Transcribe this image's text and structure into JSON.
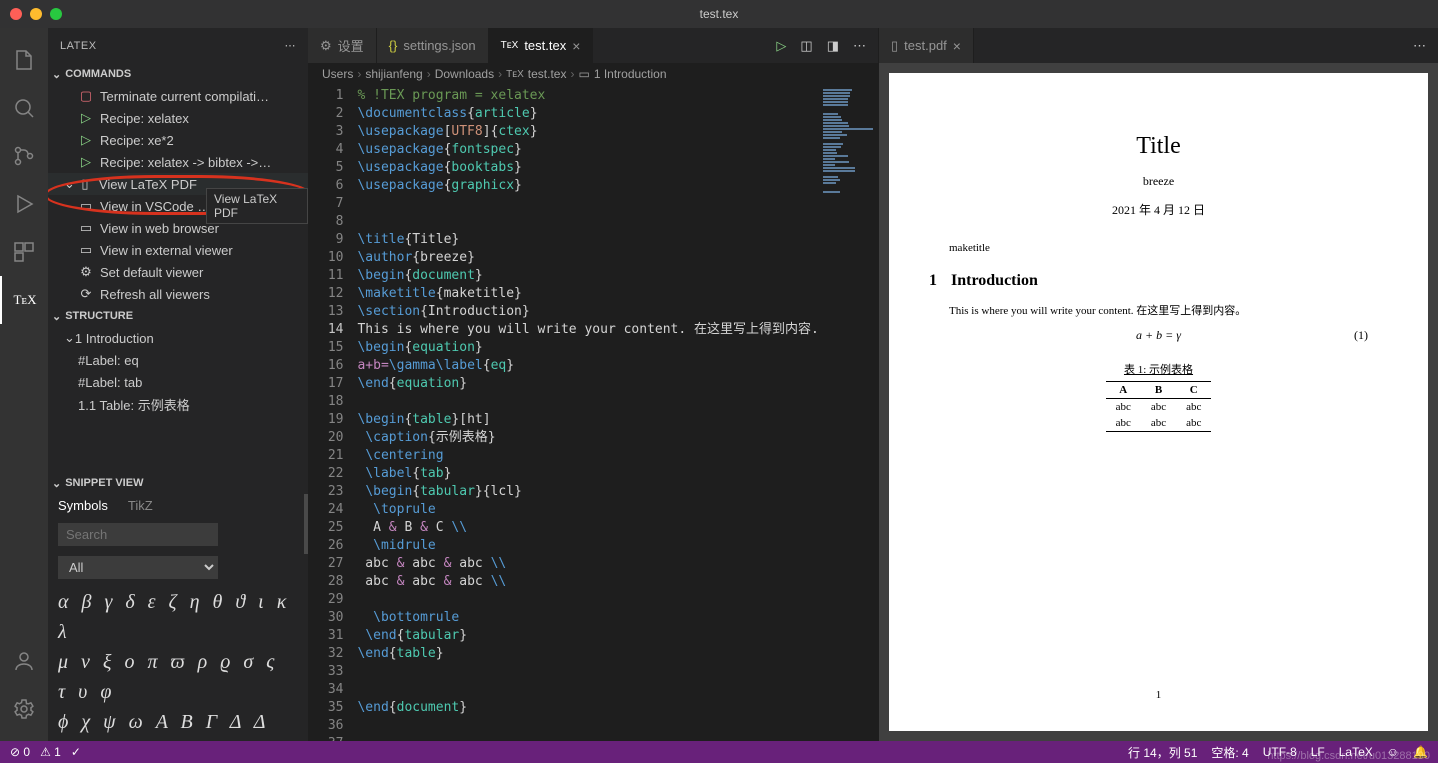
{
  "window": {
    "title": "test.tex"
  },
  "sidebar": {
    "title": "LATEX",
    "sections": {
      "commands": {
        "label": "COMMANDS",
        "items": [
          {
            "label": "Terminate current compilati…"
          },
          {
            "label": "Recipe: xelatex"
          },
          {
            "label": "Recipe: xe*2"
          },
          {
            "label": "Recipe: xelatex -> bibtex ->…"
          }
        ],
        "view_pdf": {
          "label": "View LaTeX PDF",
          "tooltip": "View LaTeX PDF"
        },
        "view_items": [
          {
            "label": "View in VSCode …"
          },
          {
            "label": "View in web browser"
          },
          {
            "label": "View in external viewer"
          },
          {
            "label": "Set default viewer"
          },
          {
            "label": "Refresh all viewers"
          }
        ]
      },
      "structure": {
        "label": "STRUCTURE",
        "items": [
          {
            "label": "1 Introduction"
          },
          {
            "label": "#Label: eq"
          },
          {
            "label": "#Label: tab"
          },
          {
            "label": "1.1 Table:  示例表格"
          }
        ]
      },
      "snippet": {
        "label": "SNIPPET VIEW",
        "tabs": {
          "symbols": "Symbols",
          "tikz": "TikZ"
        },
        "search_placeholder": "Search",
        "select_value": "All",
        "rows": [
          "α β γ δ ε ζ η θ ϑ ι κ λ",
          "μ ν ξ o π ϖ ρ ϱ σ ς τ υ φ",
          "ϕ χ ψ ω A B Γ Δ Δ"
        ]
      }
    }
  },
  "tabs": {
    "left": [
      {
        "icon": "gear",
        "label": "设置"
      },
      {
        "icon": "braces",
        "label": "settings.json"
      },
      {
        "icon": "tex",
        "label": "test.tex",
        "active": true,
        "close": true
      }
    ],
    "right": [
      {
        "icon": "file",
        "label": "test.pdf",
        "close": true
      }
    ]
  },
  "breadcrumb": [
    "Users",
    "shijianfeng",
    "Downloads",
    "test.tex",
    "1 Introduction"
  ],
  "editor": {
    "current_line": 14,
    "lines": [
      {
        "n": 1,
        "html": "<span class='tok-c'>% !TEX program = xelatex</span>"
      },
      {
        "n": 2,
        "html": "<span class='tok-k'>\\documentclass</span>{<span class='tok-f'>article</span>}"
      },
      {
        "n": 3,
        "html": "<span class='tok-k'>\\usepackage</span>[<span class='tok-s'>UTF8</span>]{<span class='tok-f'>ctex</span>}"
      },
      {
        "n": 4,
        "html": "<span class='tok-k'>\\usepackage</span>{<span class='tok-f'>fontspec</span>}"
      },
      {
        "n": 5,
        "html": "<span class='tok-k'>\\usepackage</span>{<span class='tok-f'>booktabs</span>}"
      },
      {
        "n": 6,
        "html": "<span class='tok-k'>\\usepackage</span>{<span class='tok-f'>graphicx</span>}"
      },
      {
        "n": 7,
        "html": ""
      },
      {
        "n": 8,
        "html": ""
      },
      {
        "n": 9,
        "html": "<span class='tok-k'>\\title</span>{Title}"
      },
      {
        "n": 10,
        "html": "<span class='tok-k'>\\author</span>{breeze}"
      },
      {
        "n": 11,
        "html": "<span class='tok-k'>\\begin</span>{<span class='tok-f'>document</span>}"
      },
      {
        "n": 12,
        "html": "<span class='tok-k'>\\maketitle</span>{maketitle}"
      },
      {
        "n": 13,
        "html": "<span class='tok-k'>\\section</span>{Introduction}"
      },
      {
        "n": 14,
        "html": "This is where you will write your content. 在这里写上得到内容."
      },
      {
        "n": 15,
        "html": "<span class='tok-k'>\\begin</span>{<span class='tok-f'>equation</span>}"
      },
      {
        "n": 16,
        "html": "<span class='tok-p'>a+b=</span><span class='tok-k'>\\gamma</span><span class='tok-k'>\\label</span>{<span class='tok-f'>eq</span>}"
      },
      {
        "n": 17,
        "html": "<span class='tok-k'>\\end</span>{<span class='tok-f'>equation</span>}"
      },
      {
        "n": 18,
        "html": ""
      },
      {
        "n": 19,
        "html": "<span class='tok-k'>\\begin</span>{<span class='tok-f'>table</span>}[ht]"
      },
      {
        "n": 20,
        "html": " <span class='tok-k'>\\caption</span>{示例表格}"
      },
      {
        "n": 21,
        "html": " <span class='tok-k'>\\centering</span>"
      },
      {
        "n": 22,
        "html": " <span class='tok-k'>\\label</span>{<span class='tok-f'>tab</span>}"
      },
      {
        "n": 23,
        "html": " <span class='tok-k'>\\begin</span>{<span class='tok-f'>tabular</span>}{lcl}"
      },
      {
        "n": 24,
        "html": "  <span class='tok-k'>\\toprule</span>"
      },
      {
        "n": 25,
        "html": "  A <span class='tok-p'>&amp;</span> B <span class='tok-p'>&amp;</span> C <span class='tok-k'>\\\\</span>"
      },
      {
        "n": 26,
        "html": "  <span class='tok-k'>\\midrule</span>"
      },
      {
        "n": 27,
        "html": " abc <span class='tok-p'>&amp;</span> abc <span class='tok-p'>&amp;</span> abc <span class='tok-k'>\\\\</span>"
      },
      {
        "n": 28,
        "html": " abc <span class='tok-p'>&amp;</span> abc <span class='tok-p'>&amp;</span> abc <span class='tok-k'>\\\\</span>"
      },
      {
        "n": 29,
        "html": ""
      },
      {
        "n": 30,
        "html": "  <span class='tok-k'>\\bottomrule</span>"
      },
      {
        "n": 31,
        "html": " <span class='tok-k'>\\end</span>{<span class='tok-f'>tabular</span>}"
      },
      {
        "n": 32,
        "html": "<span class='tok-k'>\\end</span>{<span class='tok-f'>table</span>}"
      },
      {
        "n": 33,
        "html": ""
      },
      {
        "n": 34,
        "html": ""
      },
      {
        "n": 35,
        "html": "<span class='tok-k'>\\end</span>{<span class='tok-f'>document</span>}"
      },
      {
        "n": 36,
        "html": ""
      },
      {
        "n": 37,
        "html": ""
      }
    ]
  },
  "pdf": {
    "title": "Title",
    "author": "breeze",
    "date": "2021 年 4 月 12 日",
    "maketitle": "maketitle",
    "section_num": "1",
    "section": "Introduction",
    "body": "This is where you will write your content. 在这里写上得到内容。",
    "eq": "a + b = γ",
    "eq_num": "(1)",
    "table_caption": "表 1: 示例表格",
    "table": {
      "head": [
        "A",
        "B",
        "C"
      ],
      "rows": [
        [
          "abc",
          "abc",
          "abc"
        ],
        [
          "abc",
          "abc",
          "abc"
        ]
      ]
    },
    "page": "1"
  },
  "statusbar": {
    "errors": "0",
    "warnings": "1",
    "pos": "行 14，列 51",
    "spaces": "空格: 4",
    "encoding": "UTF-8",
    "eol": "LF",
    "lang": "LaTeX"
  },
  "watermark": "https://blog.csdn.net/u013288190"
}
